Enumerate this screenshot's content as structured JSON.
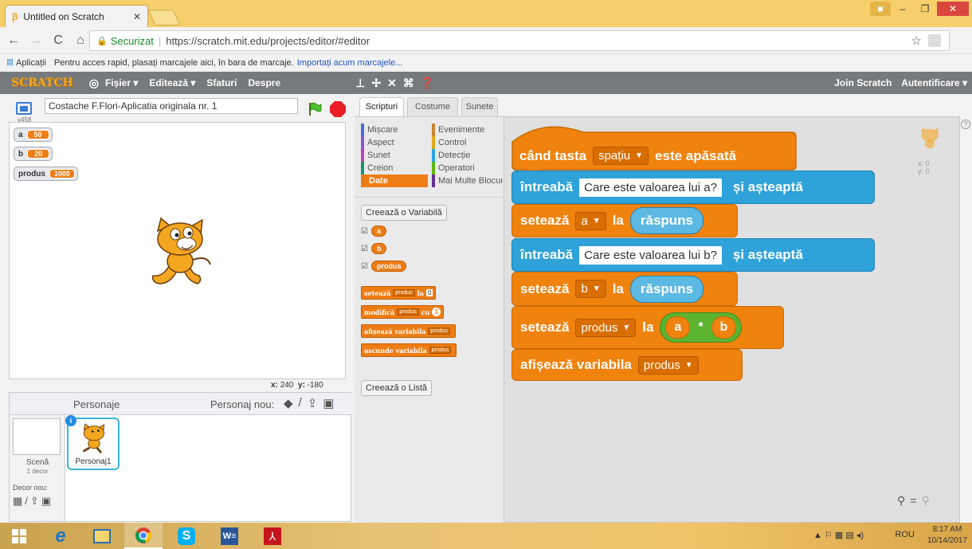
{
  "browser": {
    "tab_title": "Untitled on Scratch",
    "secure_label": "Securizat",
    "url": "https://scratch.mit.edu/projects/editor/#editor",
    "bookmarks": {
      "apps": "Aplicații",
      "prompt": "Pentru acces rapid, plasați marcajele aici, în bara de marcaje.",
      "import_link": "Importați acum marcajele..."
    }
  },
  "scratch_menu": {
    "logo": "SCRATCH",
    "file": "Fișier ▾",
    "edit": "Editează ▾",
    "tips": "Sfaturi",
    "about": "Despre",
    "join": "Join Scratch",
    "signin": "Autentificare ▾"
  },
  "stage": {
    "version": "v458",
    "project_title": "Costache F.Flori-Aplicatia originala nr. 1",
    "monitors": [
      {
        "name": "a",
        "value": "50"
      },
      {
        "name": "b",
        "value": "20"
      },
      {
        "name": "produs",
        "value": "1000"
      }
    ],
    "x_label": "x:",
    "x_value": "240",
    "y_label": "y:",
    "y_value": "-180"
  },
  "sprites": {
    "header": "Personaje",
    "new_sprite": "Personaj nou:",
    "stage_label": "Scenă",
    "backdrop_count": "1 decor",
    "new_backdrop": "Decor nou:",
    "sprite_name": "Personaj1"
  },
  "tabs": [
    "Scripturi",
    "Costume",
    "Sunete"
  ],
  "palette": {
    "categories": [
      {
        "label": "Mișcare",
        "color": "#4a6cd4"
      },
      {
        "label": "Evenimente",
        "color": "#c88330"
      },
      {
        "label": "Aspect",
        "color": "#8a55d7"
      },
      {
        "label": "Control",
        "color": "#e1a91a"
      },
      {
        "label": "Sunet",
        "color": "#bb42c3"
      },
      {
        "label": "Detecție",
        "color": "#2ca5e2"
      },
      {
        "label": "Creion",
        "color": "#0e9a6c"
      },
      {
        "label": "Operatori",
        "color": "#5cb712"
      },
      {
        "label": "Date",
        "color": "#ee7d16"
      },
      {
        "label": "Mai Multe Blocuri",
        "color": "#632d99"
      }
    ],
    "make_variable": "Creează o Variabilă",
    "variables": [
      "a",
      "b",
      "produs"
    ],
    "block_set": "setează",
    "block_set_var": "produs",
    "block_set_to": "la",
    "block_set_val": "0",
    "block_change": "modifică",
    "block_change_var": "produs",
    "block_change_by": "cu",
    "block_change_val": "1",
    "block_show": "afișează variabila",
    "block_show_var": "produs",
    "block_hide": "ascunde variabila",
    "block_hide_var": "produs",
    "make_list": "Creează o Listă"
  },
  "script": {
    "hat_when": "când tasta",
    "hat_key": "spațiu",
    "hat_pressed": "este apăsată",
    "ask1_verb": "întreabă",
    "ask1_text": "Care este valoarea lui a?",
    "ask1_wait": "și așteaptă",
    "set1_verb": "setează",
    "set1_var": "a",
    "set1_to": "la",
    "set1_val": "răspuns",
    "ask2_verb": "întreabă",
    "ask2_text": "Care este valoarea lui b?",
    "ask2_wait": "și așteaptă",
    "set2_verb": "setează",
    "set2_var": "b",
    "set2_to": "la",
    "set2_val": "răspuns",
    "set3_verb": "setează",
    "set3_var": "produs",
    "set3_to": "la",
    "op_left": "a",
    "op_sym": "*",
    "op_right": "b",
    "show_verb": "afișează variabila",
    "show_var": "produs",
    "corner_x": "x: 0",
    "corner_y": "y: 0"
  },
  "taskbar": {
    "lang": "ROU",
    "time": "8:17 AM",
    "date": "10/14/2017"
  },
  "colors": {
    "data_orange": "#ee7d16",
    "sensing_blue": "#2ea2d9",
    "operator_green": "#5bb330",
    "scratch_header": "#777a7d",
    "chrome_title": "#f6cf6b"
  }
}
